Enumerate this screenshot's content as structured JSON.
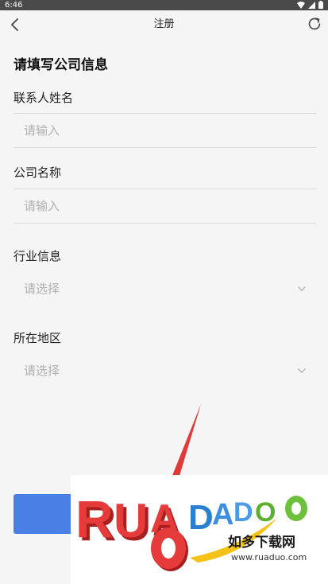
{
  "status_bar": {
    "time": "6:46"
  },
  "header": {
    "title": "注册"
  },
  "form": {
    "title": "请填写公司信息",
    "contact_name": {
      "label": "联系人姓名",
      "placeholder": "请输入"
    },
    "company_name": {
      "label": "公司名称",
      "placeholder": "请输入"
    },
    "industry": {
      "label": "行业信息",
      "value": "请选择"
    },
    "region": {
      "label": "所在地区",
      "value": "请选择"
    }
  },
  "watermark": {
    "logo_text": "RUADAUO",
    "slogan": "如多下载网",
    "url": "www.ruaduo.com"
  },
  "colors": {
    "background": "#f5f5f5",
    "status_bar": "#4a4a4a",
    "primary_button": "#4a7fe6",
    "placeholder": "#b0b0b0",
    "divider": "#dcdcdc"
  },
  "icons": {
    "back": "chevron-left-icon",
    "refresh": "refresh-icon",
    "dropdown": "chevron-down-icon"
  }
}
